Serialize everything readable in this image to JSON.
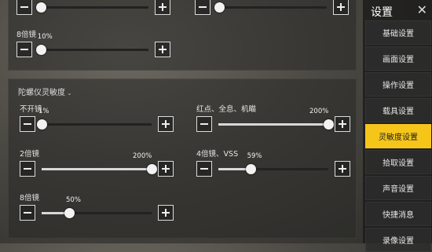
{
  "sidebar": {
    "title": "设置",
    "close": "✕",
    "items": [
      {
        "label": "基础设置"
      },
      {
        "label": "画面设置"
      },
      {
        "label": "操作设置"
      },
      {
        "label": "载具设置"
      },
      {
        "label": "灵敏度设置",
        "active": true
      },
      {
        "label": "拾取设置"
      },
      {
        "label": "声音设置"
      },
      {
        "label": "快捷消息"
      },
      {
        "label": "录像设置"
      }
    ]
  },
  "top_panel": {
    "slider_a": {
      "value_fraction": 0.02
    },
    "slider_b": {
      "value_fraction": 0.02
    },
    "slider_8x": {
      "label": "8倍镜",
      "value": "10%",
      "value_fraction": 0.02
    }
  },
  "gyro": {
    "title": "陀螺仪灵敏度",
    "sliders": [
      {
        "label": "不开镜",
        "value": "1%",
        "value_fraction": 0.0
      },
      {
        "label": "红点、全息、机瞄",
        "value": "200%",
        "value_fraction": 1.0
      },
      {
        "label": "2倍镜",
        "value": "200%",
        "value_fraction": 1.0
      },
      {
        "label": "4倍镜、VSS",
        "value": "59%",
        "value_fraction": 0.29
      },
      {
        "label": "8倍镜",
        "value": "50%",
        "value_fraction": 0.25
      }
    ]
  }
}
